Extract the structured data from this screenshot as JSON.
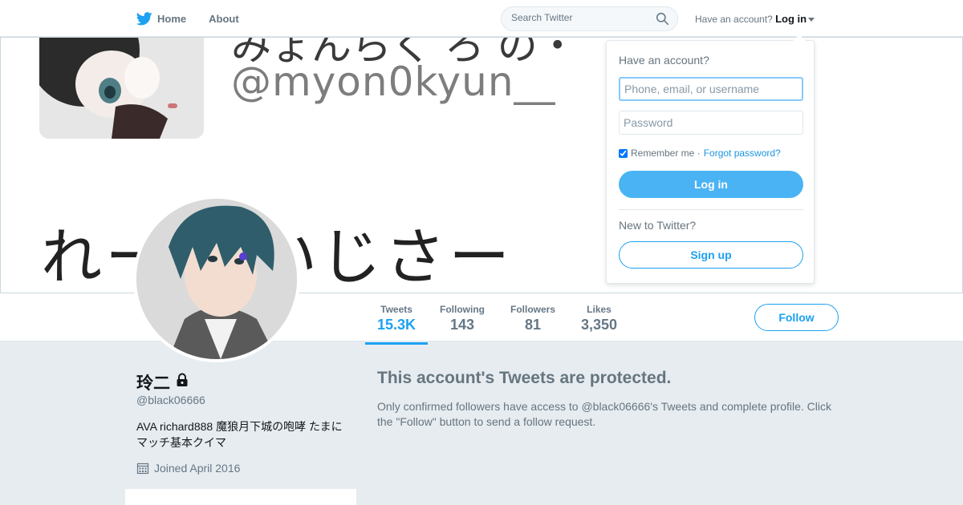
{
  "nav": {
    "home_label": "Home",
    "about_label": "About",
    "search_placeholder": "Search Twitter",
    "have_account_text": "Have an account?",
    "login_toggle_label": "Log in"
  },
  "banner": {
    "top_text": "みょんらく ろ の・",
    "handle_text": "@myon0kyun__",
    "bottom_text": "れー  れいじさー"
  },
  "stats": [
    {
      "label": "Tweets",
      "value": "15.3K"
    },
    {
      "label": "Following",
      "value": "143"
    },
    {
      "label": "Followers",
      "value": "81"
    },
    {
      "label": "Likes",
      "value": "3,350"
    }
  ],
  "follow_label": "Follow",
  "profile": {
    "name": "玲二",
    "handle": "@black06666",
    "bio": "AVA richard888 魔狼月下城の咆哮 たまにマッチ基本クイマ",
    "joined": "Joined April 2016"
  },
  "protected": {
    "title": "This account's Tweets are protected.",
    "text": "Only confirmed followers have access to @black06666's Tweets and complete profile. Click the \"Follow\" button to send a follow request."
  },
  "login_dropdown": {
    "title": "Have an account?",
    "username_placeholder": "Phone, email, or username",
    "password_placeholder": "Password",
    "remember_label": "Remember me ·",
    "forgot_label": "Forgot password?",
    "login_button": "Log in",
    "new_text": "New to Twitter?",
    "signup_button": "Sign up"
  },
  "colors": {
    "accent": "#1da1f2",
    "background": "#e6ecf0"
  }
}
